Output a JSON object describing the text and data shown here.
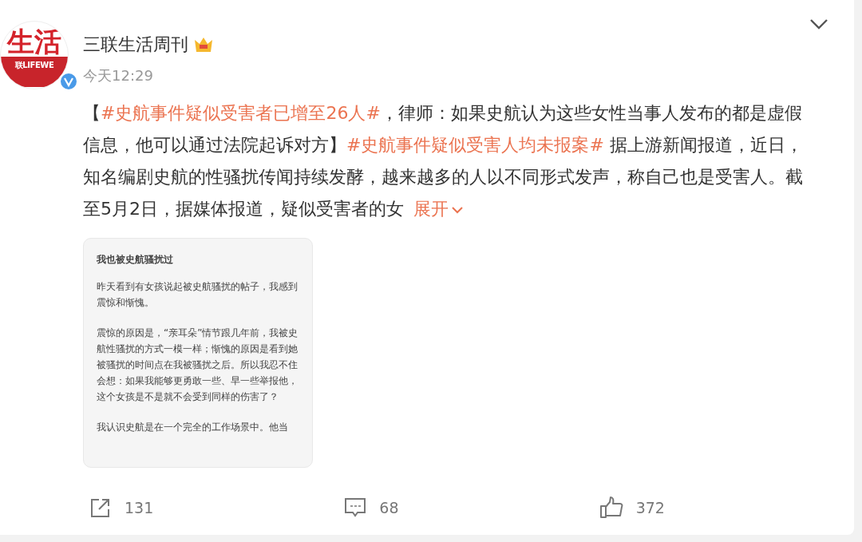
{
  "account": {
    "avatar_text": "生活",
    "avatar_subtext": "联LIFEWE",
    "verified": true,
    "name": "三联生活周刊",
    "time": "今天12:29"
  },
  "body": [
    {
      "kind": "text",
      "text": "【"
    },
    {
      "kind": "hashtag",
      "text": "#史航事件疑似受害者已增至26人#"
    },
    {
      "kind": "text",
      "text": "，律师：如果史航认为这些女性当事人发布的都是虚假信息，他可以通过法院起诉对方】"
    },
    {
      "kind": "hashtag",
      "text": "#史航事件疑似受害人均未报案#"
    },
    {
      "kind": "text",
      "text": " 据上游新闻报道，近日，知名编剧史航的性骚扰传闻持续发酵，越来越多的人以不同形式发声，称自己也是受害人。截至5月2日，据媒体报道，疑似受害者的女"
    }
  ],
  "expand": "展开",
  "image": {
    "title": "我也被史航骚扰过",
    "paragraphs": [
      "昨天看到有女孩说起被史航骚扰的帖子，我感到震惊和惭愧。",
      "震惊的原因是，“亲耳朵”情节跟几年前，我被史航性骚扰的方式一模一样；惭愧的原因是看到她被骚扰的时间点在我被骚扰之后。所以我忍不住会想：如果我能够更勇敢一些、早一些举报他，这个女孩是不是就不会受到同样的伤害了？",
      "我认识史航是在一个完全的工作场景中。他当"
    ]
  },
  "actions": [
    {
      "kind": "share",
      "count": "131"
    },
    {
      "kind": "comment",
      "count": "68"
    },
    {
      "kind": "like",
      "count": "372"
    }
  ]
}
